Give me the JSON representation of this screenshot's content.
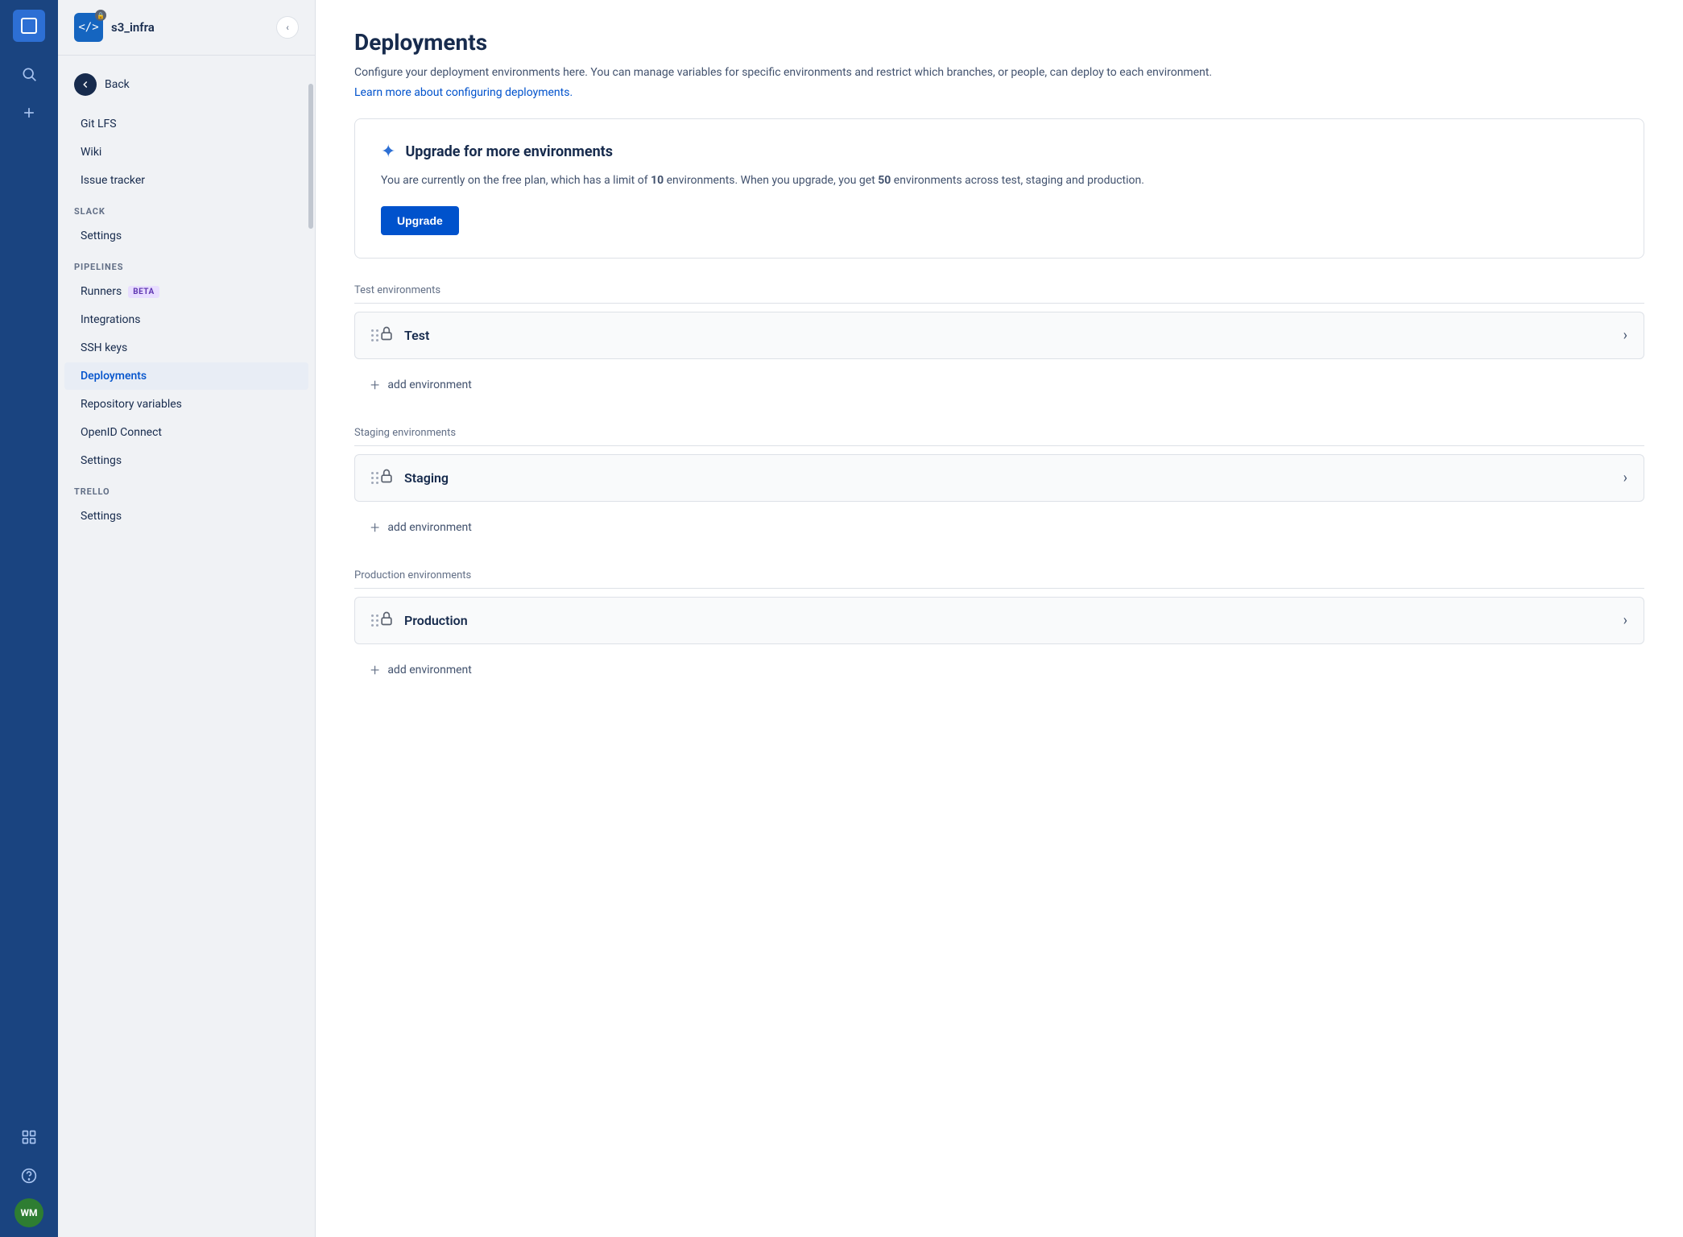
{
  "iconBar": {
    "logo": "⊞",
    "searchLabel": "Search",
    "addLabel": "Add",
    "appsLabel": "Apps",
    "helpLabel": "Help",
    "avatarInitials": "WM",
    "avatarColor": "#2e7d32"
  },
  "sidebar": {
    "repoName": "s3_infra",
    "backLabel": "Back",
    "items": [
      {
        "id": "git-lfs",
        "label": "Git LFS",
        "active": false,
        "section": null
      },
      {
        "id": "wiki",
        "label": "Wiki",
        "active": false,
        "section": null
      },
      {
        "id": "issue-tracker",
        "label": "Issue tracker",
        "active": false,
        "section": null
      }
    ],
    "sections": {
      "slack": {
        "label": "SLACK",
        "items": [
          {
            "id": "slack-settings",
            "label": "Settings",
            "active": false
          }
        ]
      },
      "pipelines": {
        "label": "PIPELINES",
        "items": [
          {
            "id": "runners",
            "label": "Runners",
            "active": false,
            "badge": "BETA"
          },
          {
            "id": "integrations",
            "label": "Integrations",
            "active": false
          },
          {
            "id": "ssh-keys",
            "label": "SSH keys",
            "active": false
          },
          {
            "id": "deployments",
            "label": "Deployments",
            "active": true
          },
          {
            "id": "repo-variables",
            "label": "Repository variables",
            "active": false
          },
          {
            "id": "openid-connect",
            "label": "OpenID Connect",
            "active": false
          },
          {
            "id": "pipeline-settings",
            "label": "Settings",
            "active": false
          }
        ]
      },
      "trello": {
        "label": "TRELLO",
        "items": [
          {
            "id": "trello-settings",
            "label": "Settings",
            "active": false
          }
        ]
      }
    }
  },
  "main": {
    "title": "Deployments",
    "description": "Configure your deployment environments here. You can manage variables for specific environments and restrict which branches, or people, can deploy to each environment.",
    "learnLink": "Learn more about configuring deployments.",
    "upgradeCard": {
      "title": "Upgrade for more environments",
      "description": "You are currently on the free plan, which has a limit of ",
      "limit": "10",
      "descriptionMid": " environments. When you upgrade, you get ",
      "upgradeLimit": "50",
      "descriptionEnd": " environments across test, staging and production.",
      "buttonLabel": "Upgrade"
    },
    "sections": [
      {
        "id": "test",
        "label": "Test environments",
        "environments": [
          {
            "name": "Test"
          }
        ],
        "addLabel": "add environment"
      },
      {
        "id": "staging",
        "label": "Staging environments",
        "environments": [
          {
            "name": "Staging"
          }
        ],
        "addLabel": "add environment"
      },
      {
        "id": "production",
        "label": "Production environments",
        "environments": [
          {
            "name": "Production"
          }
        ],
        "addLabel": "add environment"
      }
    ]
  }
}
